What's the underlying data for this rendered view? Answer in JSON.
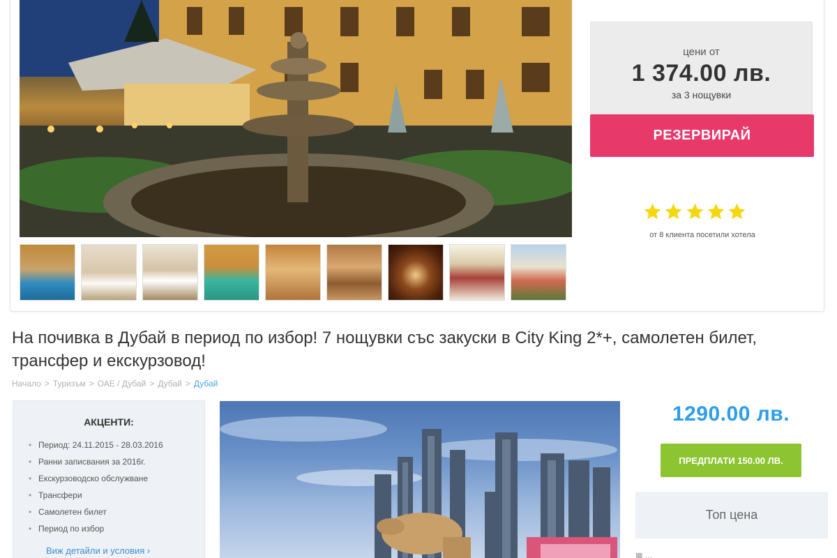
{
  "hotel_offer": {
    "price_from_label": "цени от",
    "price": "1 374.00 лв.",
    "nights": "за 3 нощувки",
    "reserve_label": "РЕЗЕРВИРАЙ",
    "stars": 5,
    "star_color": "#f5d60f",
    "rating_note": "от 8 клиента посетили хотела",
    "thumbnails": [
      "pool",
      "bedroom",
      "bedroom-twin",
      "indoor-pool",
      "spa-room",
      "sauna",
      "spa-bowl",
      "restaurant",
      "exterior-view"
    ]
  },
  "deal": {
    "title": "На почивка в Дубай в период по избор! 7 нощувки със закуски в City King 2*+, самолетен билет, трансфер и екскурзовод!",
    "breadcrumb": [
      "Начало",
      "Туризъм",
      "ОАЕ / Дубай",
      "Дубай",
      "Дубай"
    ],
    "breadcrumb_separator": ">",
    "highlights_title": "АКЦЕНТИ:",
    "highlights": [
      "Период: 24.11.2015 - 28.03.2016",
      "Ранни записвания за 2016г.",
      "Екскурзоводско обслужване",
      "Трансфери",
      "Самолетен билет",
      "Период по избор"
    ],
    "details_link": "Виж детайли и условия",
    "price": "1290.00 лв.",
    "prepay_label": "ПРЕДПЛАТИ 150.00 ЛВ.",
    "top_price_label": "Топ цена",
    "footer_partial": "…"
  },
  "colors": {
    "accent_pink": "#e8396b",
    "accent_green": "#8dc431",
    "accent_blue": "#2d9ee8",
    "link_blue": "#3f8fd2"
  }
}
